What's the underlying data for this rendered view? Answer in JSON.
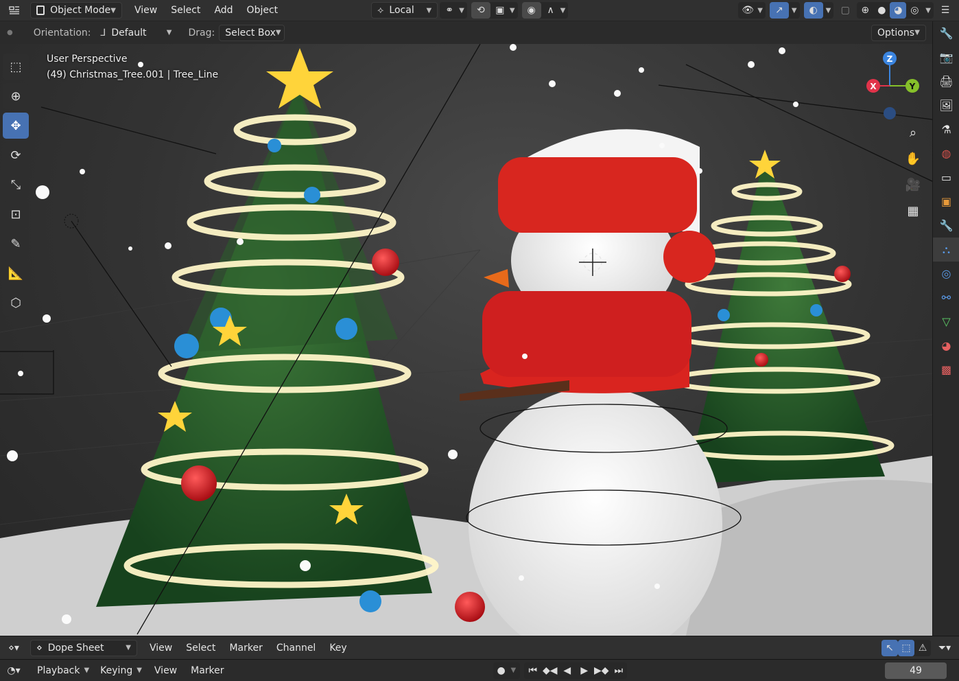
{
  "header": {
    "mode": "Object Mode",
    "menus": [
      "View",
      "Select",
      "Add",
      "Object"
    ],
    "transform_orientation": "Local",
    "options_label": "Options"
  },
  "tool_options": {
    "orientation_label": "Orientation:",
    "orientation_value": "Default",
    "drag_label": "Drag:",
    "drag_value": "Select Box"
  },
  "viewport": {
    "view_name": "User Perspective",
    "object_info": "(49) Christmas_Tree.001 | Tree_Line",
    "gizmo": {
      "x": "X",
      "y": "Y",
      "z": "Z"
    }
  },
  "toolbar": [
    "select-box",
    "cursor",
    "move",
    "rotate",
    "scale",
    "transform",
    "annotate",
    "measure",
    "add-cube"
  ],
  "dopesheet": {
    "editor": "Dope Sheet",
    "menus": [
      "View",
      "Select",
      "Marker",
      "Channel",
      "Key"
    ]
  },
  "timeline": {
    "playback": "Playback",
    "keying": "Keying",
    "menus": [
      "View",
      "Marker"
    ],
    "current_frame": "49"
  },
  "colors": {
    "accent": "#4772b3",
    "axis_x": "#e1334a",
    "axis_y": "#86c02a",
    "axis_z": "#3b85e0"
  }
}
